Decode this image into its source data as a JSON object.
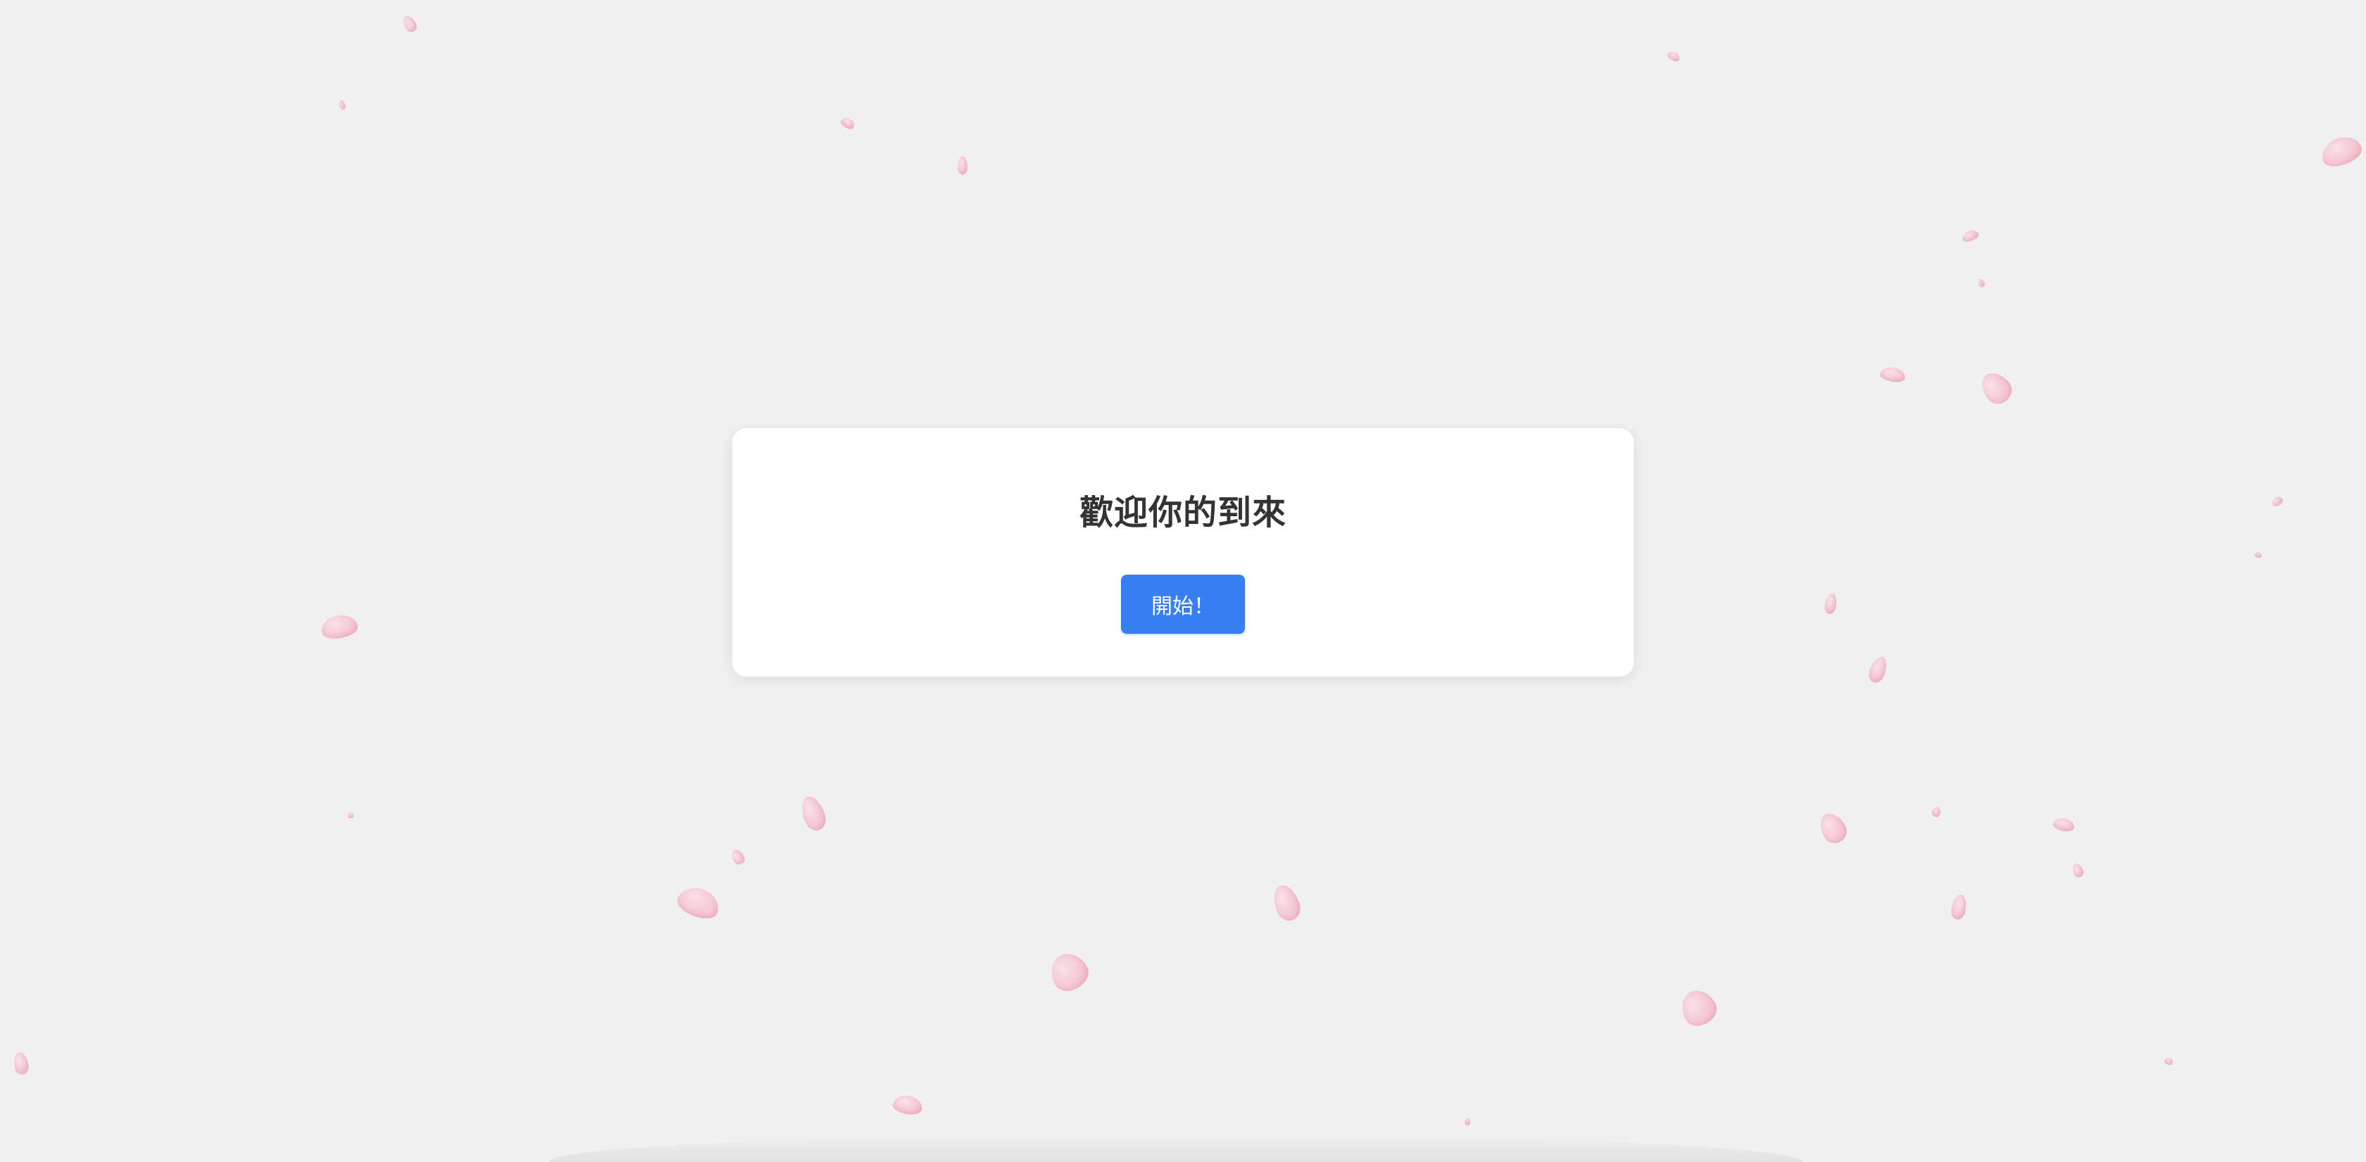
{
  "welcome": {
    "title": "歡迎你的到來",
    "start_label": "開始！"
  },
  "colors": {
    "background": "#f0f0f0",
    "card": "#ffffff",
    "button": "#3a7ef6",
    "petal": "#f6c2cf"
  }
}
